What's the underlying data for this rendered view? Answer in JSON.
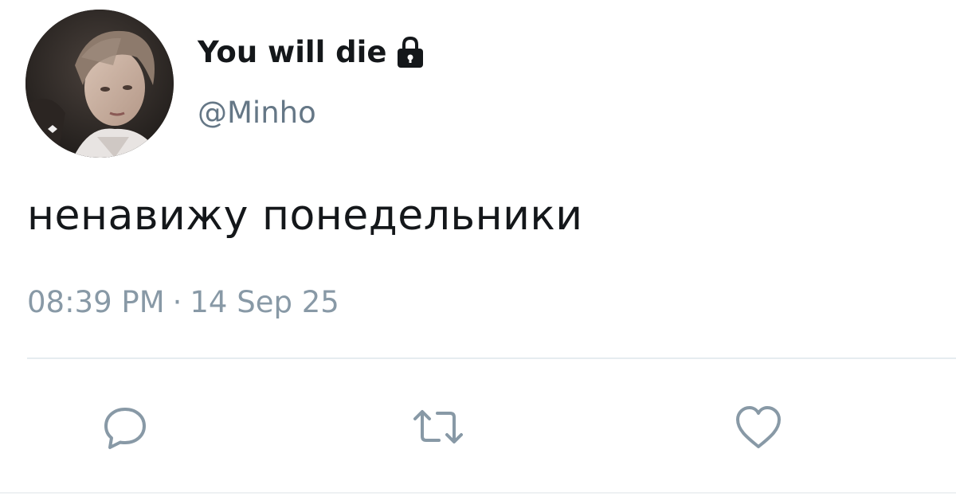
{
  "user": {
    "display_name": "You will die",
    "handle": "@Minho",
    "avatar_icon": "profile-photo",
    "lock_icon": "lock-icon"
  },
  "tweet": {
    "text": "ненавижу понедельники",
    "time": "08:39 PM",
    "separator": "·",
    "date": "14 Sep 25"
  },
  "actions": {
    "reply_icon": "reply-icon",
    "retweet_icon": "retweet-icon",
    "like_icon": "heart-icon"
  },
  "colors": {
    "text_primary": "#14171a",
    "text_secondary": "#657786",
    "meta": "#8899a6",
    "icon": "#8899a6",
    "divider": "#e6ecf0"
  }
}
